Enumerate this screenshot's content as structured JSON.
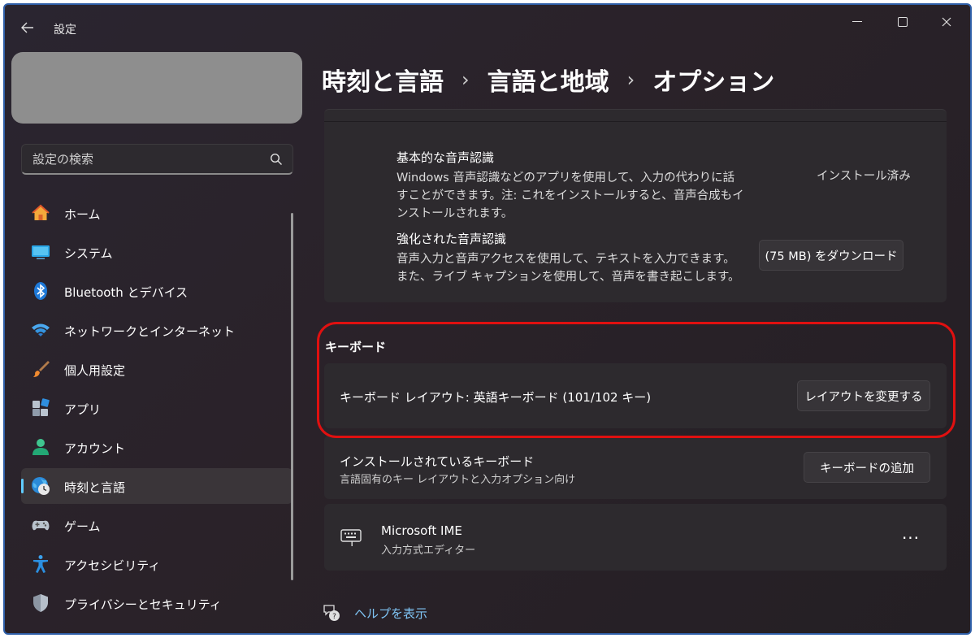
{
  "window": {
    "title": "設定",
    "controls": {
      "minimize": "—",
      "maximize": "☐",
      "close": "✕"
    }
  },
  "search": {
    "placeholder": "設定の検索"
  },
  "sidebar": {
    "items": [
      {
        "label": "ホーム",
        "icon": "home-icon"
      },
      {
        "label": "システム",
        "icon": "monitor-icon"
      },
      {
        "label": "Bluetooth とデバイス",
        "icon": "bluetooth-icon"
      },
      {
        "label": "ネットワークとインターネット",
        "icon": "wifi-icon"
      },
      {
        "label": "個人用設定",
        "icon": "paintbrush-icon"
      },
      {
        "label": "アプリ",
        "icon": "apps-icon"
      },
      {
        "label": "アカウント",
        "icon": "person-icon"
      },
      {
        "label": "時刻と言語",
        "icon": "globe-clock-icon",
        "selected": true
      },
      {
        "label": "ゲーム",
        "icon": "gamepad-icon"
      },
      {
        "label": "アクセシビリティ",
        "icon": "accessibility-icon"
      },
      {
        "label": "プライバシーとセキュリティ",
        "icon": "shield-icon"
      }
    ]
  },
  "breadcrumb": [
    "時刻と言語",
    "言語と地域",
    "オプション"
  ],
  "speech": {
    "basic": {
      "title": "基本的な音声認識",
      "desc": "Windows 音声認識などのアプリを使用して、入力の代わりに話すことができます。注: これをインストールすると、音声合成もインストールされます。",
      "status": "インストール済み"
    },
    "enhanced": {
      "title": "強化された音声認識",
      "desc": "音声入力と音声アクセスを使用して、テキストを入力できます。また、ライブ キャプションを使用して、音声を書き起こします。",
      "button": "(75 MB) をダウンロード"
    }
  },
  "keyboard": {
    "heading": "キーボード",
    "layout_text": "キーボード レイアウト: 英語キーボード (101/102 キー)",
    "layout_button": "レイアウトを変更する",
    "installed_title": "インストールされているキーボード",
    "installed_sub": "言語固有のキー レイアウトと入力オプション向け",
    "add_button": "キーボードの追加",
    "ime_name": "Microsoft IME",
    "ime_sub": "入力方式エディター",
    "more": "···"
  },
  "help": {
    "label": "ヘルプを表示"
  },
  "colors": {
    "accent": "#60cdff",
    "highlight": "#e01010",
    "link": "#7fc4f5"
  }
}
